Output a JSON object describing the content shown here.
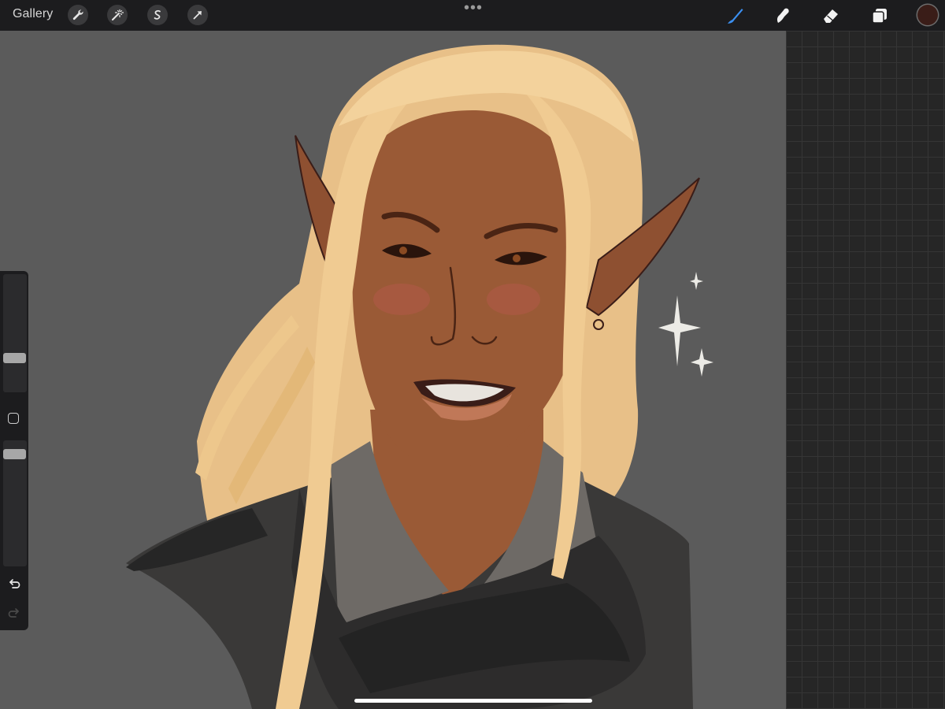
{
  "toolbar": {
    "gallery_label": "Gallery",
    "left_tools": [
      "wrench-icon",
      "magic-wand-icon",
      "selection-icon",
      "transform-arrow-icon"
    ],
    "more_glyph": "•••",
    "right_tools": [
      "brush-icon",
      "smudge-icon",
      "eraser-icon",
      "layers-icon"
    ],
    "active_tool": "brush-icon",
    "active_tool_color": "#3b8ff0",
    "current_color": "#3a1d18"
  },
  "sidebar": {
    "brush_size_level": 0.22,
    "brush_opacity_level": 0.93
  },
  "colors": {
    "canvas_bg": "#5b5b5b",
    "skin": "#9a5a36",
    "hair": "#edc78c",
    "scarf": "#2d2c2c",
    "collar": "#6e6a66"
  }
}
